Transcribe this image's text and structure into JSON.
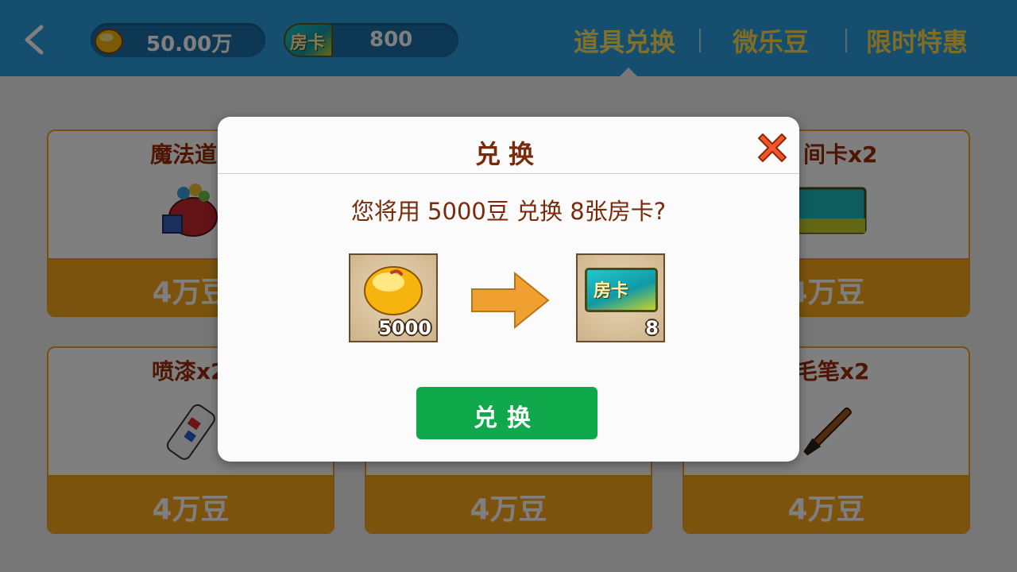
{
  "header": {
    "coin_balance": "50.00万",
    "card_icon_label": "房卡",
    "card_balance": "800",
    "tabs": [
      {
        "label": "道具兑换"
      },
      {
        "label": "微乐豆"
      },
      {
        "label": "限时特惠"
      }
    ],
    "active_tab": "道具兑换"
  },
  "products": [
    {
      "name": "魔法道具",
      "price": "4万豆",
      "icon": "gift-bag-icon"
    },
    {
      "name": "间卡x2",
      "price": "4万豆",
      "icon": "room-card-icon"
    },
    {
      "name": "喷漆x2",
      "price": "4万豆",
      "icon": "spray-can-icon"
    },
    {
      "name": "",
      "price": "4万豆",
      "icon": ""
    },
    {
      "name": "毛笔x2",
      "price": "4万豆",
      "icon": "brush-icon"
    }
  ],
  "dialog": {
    "title": "兑换",
    "question": "您将用  5000豆  兑换  8张房卡?",
    "from_qty": "5000",
    "to_card_label": "房卡",
    "to_qty": "8",
    "confirm_label": "兑换"
  },
  "colors": {
    "topbar": "#2c9ce0",
    "tab_text": "#ffd84a",
    "card_border": "#f0a020",
    "price_bar": "#f7a61b",
    "title_text": "#7a2a0a",
    "confirm_button": "#0fa84a"
  }
}
